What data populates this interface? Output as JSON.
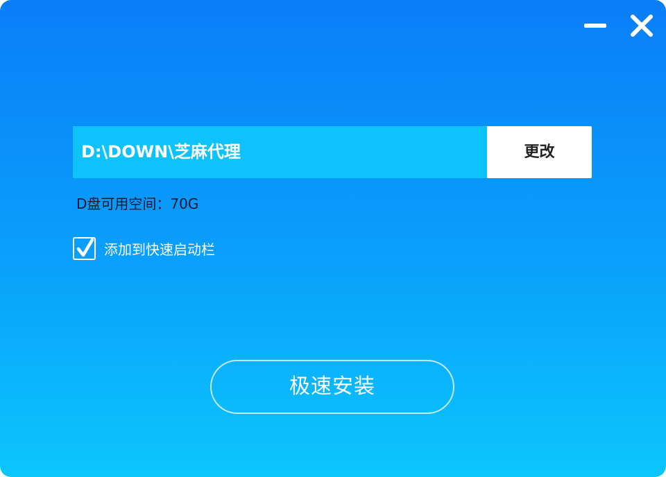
{
  "window": {
    "controls": {
      "minimize_icon": "minimize-icon",
      "close_icon": "close-icon"
    }
  },
  "install_path": {
    "value": "D:\\DOWN\\芝麻代理",
    "change_label": "更改"
  },
  "disk_space": {
    "label": "D盘可用空间：",
    "value": "70G"
  },
  "quick_launch": {
    "checked": true,
    "label": "添加到快速启动栏"
  },
  "install_button": {
    "label": "极速安装"
  },
  "colors": {
    "gradient_top": "#0a7ef8",
    "gradient_bottom": "#0cc6fc",
    "path_field_bg": "#0ec3fb",
    "button_white": "#ffffff"
  }
}
